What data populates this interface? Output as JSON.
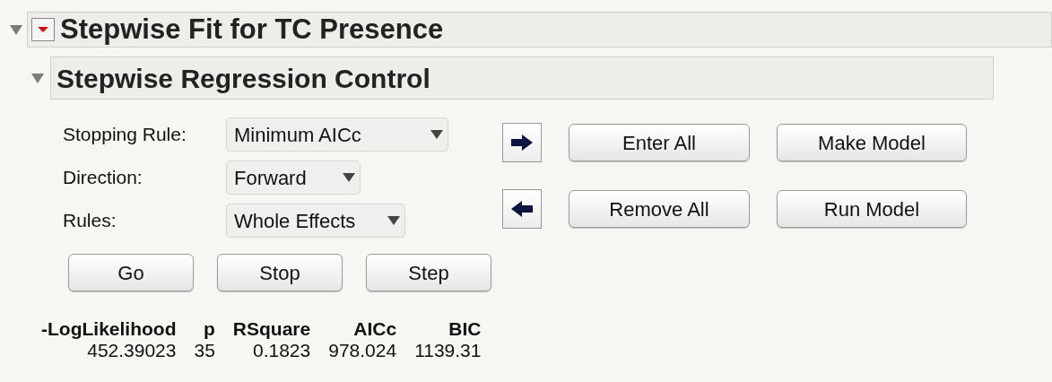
{
  "report": {
    "title": "Stepwise Fit for TC Presence",
    "expanded": true
  },
  "section": {
    "title": "Stepwise Regression Control",
    "expanded": true
  },
  "settings": [
    {
      "label": "Stopping Rule:",
      "value": "Minimum AICc"
    },
    {
      "label": "Direction:",
      "value": "Forward"
    },
    {
      "label": "Rules:",
      "value": "Whole Effects"
    }
  ],
  "action_rows": [
    {
      "buttons": [
        "Enter All",
        "Make Model"
      ]
    },
    {
      "buttons": [
        "Remove All",
        "Run Model"
      ]
    }
  ],
  "run_buttons": [
    "Go",
    "Stop",
    "Step"
  ],
  "table": {
    "columns": [
      "-LogLikelihood",
      "p",
      "RSquare",
      "AICc",
      "BIC"
    ],
    "rows": [
      [
        "452.39023",
        "35",
        "0.1823",
        "978.024",
        "1139.31"
      ]
    ]
  }
}
